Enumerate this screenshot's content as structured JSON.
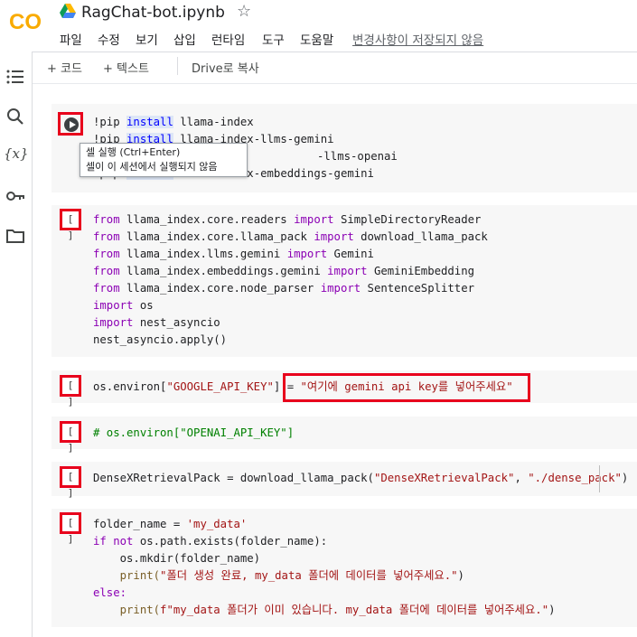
{
  "header": {
    "title": "RagChat-bot.ipynb",
    "logo_text": "CO",
    "menu": [
      "파일",
      "수정",
      "보기",
      "삽입",
      "런타임",
      "도구",
      "도움말"
    ],
    "unsaved_notice": "변경사항이 저장되지 않음"
  },
  "toolbar": {
    "add_code": "+ 코드",
    "add_text": "+ 텍스트",
    "copy_to_drive": "Drive로 복사"
  },
  "rail": {
    "icons": [
      "table-of-contents-icon",
      "search-icon",
      "variables-icon",
      "secrets-key-icon",
      "files-folder-icon"
    ],
    "variables_glyph": "{x}"
  },
  "tooltip": {
    "line1": "셀 실행 (Ctrl+Enter)",
    "line2": "셀이 이 세션에서 실행되지 않음"
  },
  "cells": {
    "empty_bracket": "[ ]",
    "c1": [
      "!pip install llama-index",
      "!pip install llama-index-llms-gemini",
      "!pip install llama-index-llms-openai",
      "!pip install llama-index-embeddings-gemini"
    ],
    "c1_visible": {
      "l1a": "!pip ",
      "l1b": "install",
      "l1c": " llama-index",
      "l2a": "!pip ",
      "l2b": "install",
      "l2c": " llama-index-llms-gemini",
      "l3c": "-llms-openai",
      "l4a": "!pip ",
      "l4b": "install",
      "l4c": " llama-index-embeddings-gemini"
    },
    "c2": {
      "from": "from",
      "import": "import",
      "m1": " llama_index.core.readers ",
      "n1": " SimpleDirectoryReader",
      "m2": " llama_index.core.llama_pack ",
      "n2": " download_llama_pack",
      "m3": " llama_index.llms.gemini ",
      "n3": " Gemini",
      "m4": " llama_index.embeddings.gemini ",
      "n4": " GeminiEmbedding",
      "m5": " llama_index.core.node_parser ",
      "n5": " SentenceSplitter",
      "n6": " os",
      "n7": " nest_asyncio",
      "l8": "nest_asyncio.apply()"
    },
    "c3": {
      "pre": "os.environ[",
      "key": "\"GOOGLE_API_KEY\"",
      "mid": "] = ",
      "value": "\"여기에 gemini api key를 넣어주세요\""
    },
    "c4": "# os.environ[\"OPENAI_API_KEY\"]",
    "c5": {
      "pre": "DenseXRetrievalPack = download_llama_pack(",
      "a1": "\"DenseXRetrievalPack\"",
      "sep": ", ",
      "a2": "\"./dense_pack\"",
      "post": ")"
    },
    "c6": {
      "l1a": "folder_name = ",
      "l1b": "'my_data'",
      "l2a": "if",
      "l2b": " not",
      "l2c": " os.path.exists(folder_name):",
      "l3": "    os.mkdir(folder_name)",
      "l4a": "    print(",
      "l4b": "\"폴더 생성 완료, my_data 폴더에 데이터를 넣어주세요.\"",
      "l4c": ")",
      "l5": "else:",
      "l6a": "    print(",
      "l6b": "f\"my_data 폴더가 이미 있습니다. my_data 폴더에 데이터를 넣어주세요.\"",
      "l6c": ")"
    }
  },
  "colors": {
    "highlight_red": "#e8001c",
    "keyword": "#8b00b4",
    "string": "#a31515",
    "comment": "#008000",
    "cell_bg": "#f7f7f7",
    "colab_orange": "#f9ab00"
  }
}
